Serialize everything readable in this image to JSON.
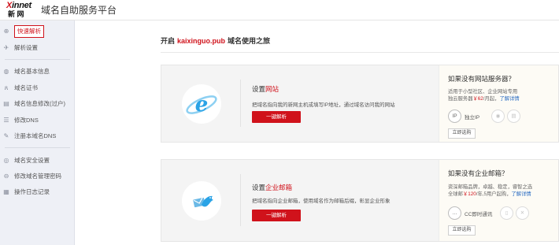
{
  "header": {
    "logo_top": "Xinnet",
    "logo_bottom": "新 网",
    "title": "域名自助服务平台"
  },
  "sidebar": {
    "groups": [
      [
        {
          "label": "快速解析",
          "icon": "globe-icon",
          "active": true
        },
        {
          "label": "解析设置",
          "icon": "plane-icon",
          "active": false
        }
      ],
      [
        {
          "label": "域名基本信息",
          "icon": "globe-icon",
          "active": false
        },
        {
          "label": "域名证书",
          "icon": "ribbon-icon",
          "active": false
        },
        {
          "label": "域名信息修改(过户)",
          "icon": "id-card-icon",
          "active": false
        },
        {
          "label": "修改DNS",
          "icon": "server-icon",
          "active": false
        },
        {
          "label": "注册本域名DNS",
          "icon": "edit-icon",
          "active": false
        }
      ],
      [
        {
          "label": "域名安全设置",
          "icon": "shield-icon",
          "active": false
        },
        {
          "label": "修改域名管理密码",
          "icon": "lock-icon",
          "active": false
        },
        {
          "label": "操作日志记录",
          "icon": "log-icon",
          "active": false
        }
      ]
    ]
  },
  "intro": {
    "prefix": "开启",
    "domain": "kaixinguo.pub",
    "suffix": "域名使用之旅"
  },
  "website_card": {
    "icon": "ie-browser-icon",
    "title_prefix": "设置",
    "title_highlight": "网站",
    "description": "把域名指向我的新网主机或填写IP地址，通过域名访问我的网站",
    "button": "一键解析",
    "right_title": "如果没有网站服务器？",
    "right_desc_1": "适用于小型社区、企业网站专用",
    "right_desc_2_prefix": "独云服务器",
    "right_price": "￥62",
    "right_desc_2_suffix": "/月起，",
    "right_more": "了解详情",
    "feature_main_glyph": "IP",
    "feature_main_label": "独立IP",
    "right_button": "立即选购"
  },
  "email_card": {
    "icon": "bird-mail-icon",
    "title_prefix": "设置",
    "title_highlight": "企业邮箱",
    "description": "把域名指向企业邮箱，使用域名作为邮箱后缀，彰显企业形象",
    "button": "一键解析",
    "right_title": "如果没有企业邮箱？",
    "right_desc_1": "资深邮箱品牌，卓越、稳定，睿智之选",
    "right_desc_2_prefix": "全球邮",
    "right_price": "￥120",
    "right_desc_2_suffix": "/年,5用户起购，",
    "right_more": "了解详情",
    "feature_main_glyph": "…",
    "feature_main_label": "CC即时通讯",
    "right_button": "立即选购"
  },
  "colors": {
    "accent": "#d0121b",
    "link": "#2a6cc2",
    "sidebar_bg": "#eef0f6",
    "card_bg": "#f4f4f4"
  }
}
